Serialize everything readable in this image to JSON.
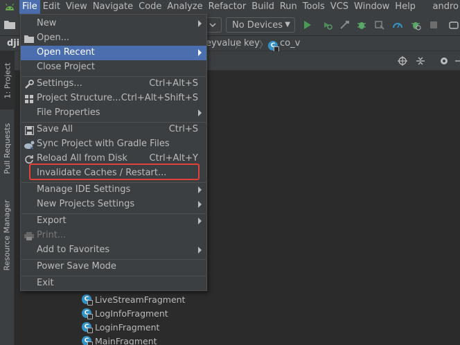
{
  "menubar": {
    "items": [
      "File",
      "Edit",
      "View",
      "Navigate",
      "Code",
      "Analyze",
      "Refactor",
      "Build",
      "Run",
      "Tools",
      "VCS",
      "Window",
      "Help"
    ],
    "right_text": "andro"
  },
  "toolbar": {
    "devices_label": "No Devices"
  },
  "breadcrumb": {
    "project_fragment": "dji",
    "items": [
      "eyvalue",
      "key",
      "co_v"
    ]
  },
  "left_strip": {
    "tabs": [
      "1: Project",
      "Pull Requests",
      "Resource Manager"
    ]
  },
  "file_menu": {
    "items": [
      {
        "label": "New",
        "shortcut": "",
        "submenu": true
      },
      {
        "label": "Open...",
        "shortcut": "",
        "submenu": false
      },
      {
        "label": "Open Recent",
        "shortcut": "",
        "submenu": true
      },
      {
        "label": "Close Project",
        "shortcut": "",
        "submenu": false
      },
      {
        "label": "Settings...",
        "shortcut": "Ctrl+Alt+S",
        "submenu": false
      },
      {
        "label": "Project Structure...",
        "shortcut": "Ctrl+Alt+Shift+S",
        "submenu": false
      },
      {
        "label": "File Properties",
        "shortcut": "",
        "submenu": true
      },
      {
        "label": "Save All",
        "shortcut": "Ctrl+S",
        "submenu": false
      },
      {
        "label": "Sync Project with Gradle Files",
        "shortcut": "",
        "submenu": false
      },
      {
        "label": "Reload All from Disk",
        "shortcut": "Ctrl+Alt+Y",
        "submenu": false
      },
      {
        "label": "Invalidate Caches / Restart...",
        "shortcut": "",
        "submenu": false
      },
      {
        "label": "Manage IDE Settings",
        "shortcut": "",
        "submenu": true
      },
      {
        "label": "New Projects Settings",
        "shortcut": "",
        "submenu": true
      },
      {
        "label": "Export",
        "shortcut": "",
        "submenu": true
      },
      {
        "label": "Print...",
        "shortcut": "",
        "submenu": false
      },
      {
        "label": "Add to Favorites",
        "shortcut": "",
        "submenu": true
      },
      {
        "label": "Power Save Mode",
        "shortcut": "",
        "submenu": false
      },
      {
        "label": "Exit",
        "shortcut": "",
        "submenu": false
      }
    ]
  },
  "tree": {
    "items": [
      "LiveStreamFragment",
      "LogInfoFragment",
      "LoginFragment",
      "MainFragment"
    ]
  },
  "colors": {
    "selection": "#4b6eaf",
    "highlight_box": "#e0413a",
    "class_icon": "#3592c4"
  }
}
